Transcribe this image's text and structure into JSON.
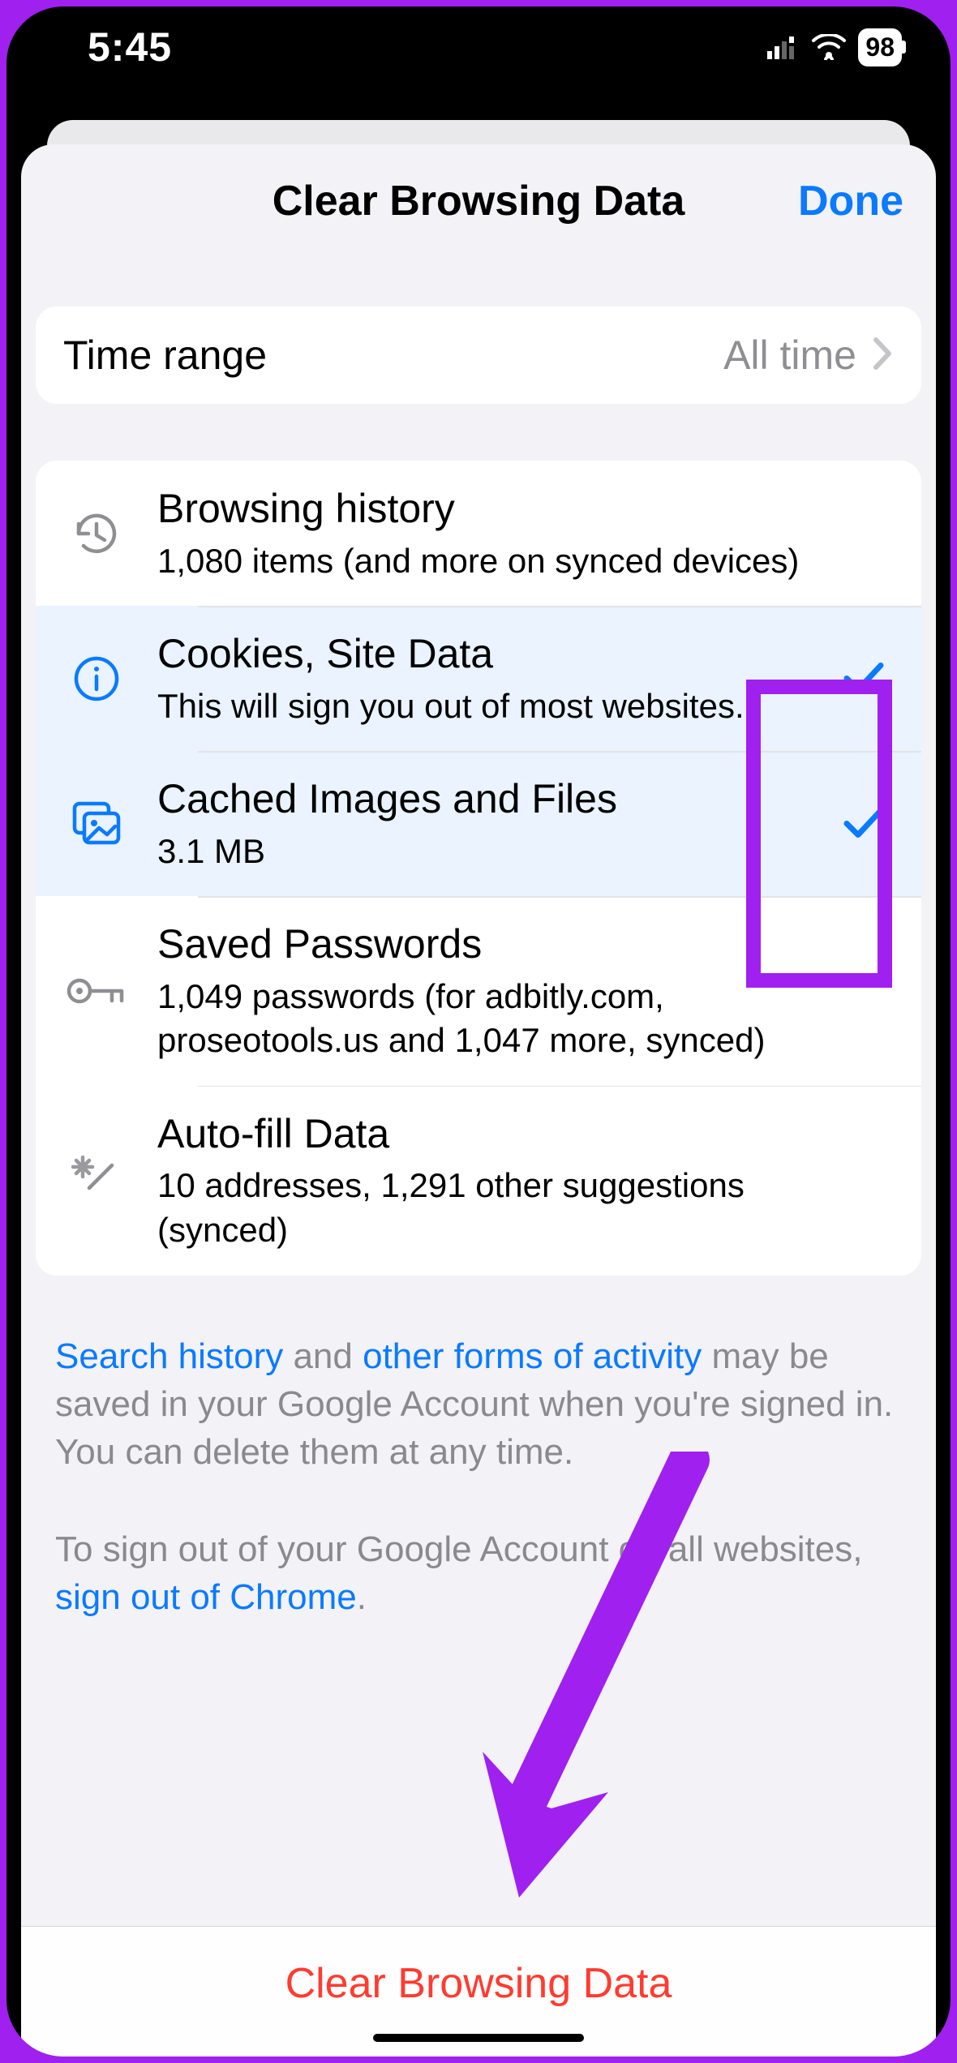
{
  "statusbar": {
    "time": "5:45",
    "battery": "98"
  },
  "sheet": {
    "title": "Clear Browsing Data",
    "done": "Done"
  },
  "time_range": {
    "label": "Time range",
    "value": "All time"
  },
  "items": {
    "history": {
      "title": "Browsing history",
      "sub": "1,080 items (and more on synced devices)"
    },
    "cookies": {
      "title": "Cookies, Site Data",
      "sub": "This will sign you out of most websites."
    },
    "cache": {
      "title": "Cached Images and Files",
      "sub": "3.1 MB"
    },
    "passwords": {
      "title": "Saved Passwords",
      "sub": "1,049 passwords (for adbitly.com, proseotools.us and 1,047 more, synced)"
    },
    "autofill": {
      "title": "Auto-fill Data",
      "sub": "10 addresses, 1,291 other suggestions (synced)"
    }
  },
  "footer": {
    "p1_link1": "Search history",
    "p1_mid": " and ",
    "p1_link2": "other forms of activity",
    "p1_rest": " may be saved in your Google Account when you're signed in. You can delete them at any time.",
    "p2_pre": "To sign out of your Google Account on all websites, ",
    "p2_link": "sign out of Chrome",
    "p2_post": "."
  },
  "action": {
    "clear": "Clear Browsing Data"
  }
}
